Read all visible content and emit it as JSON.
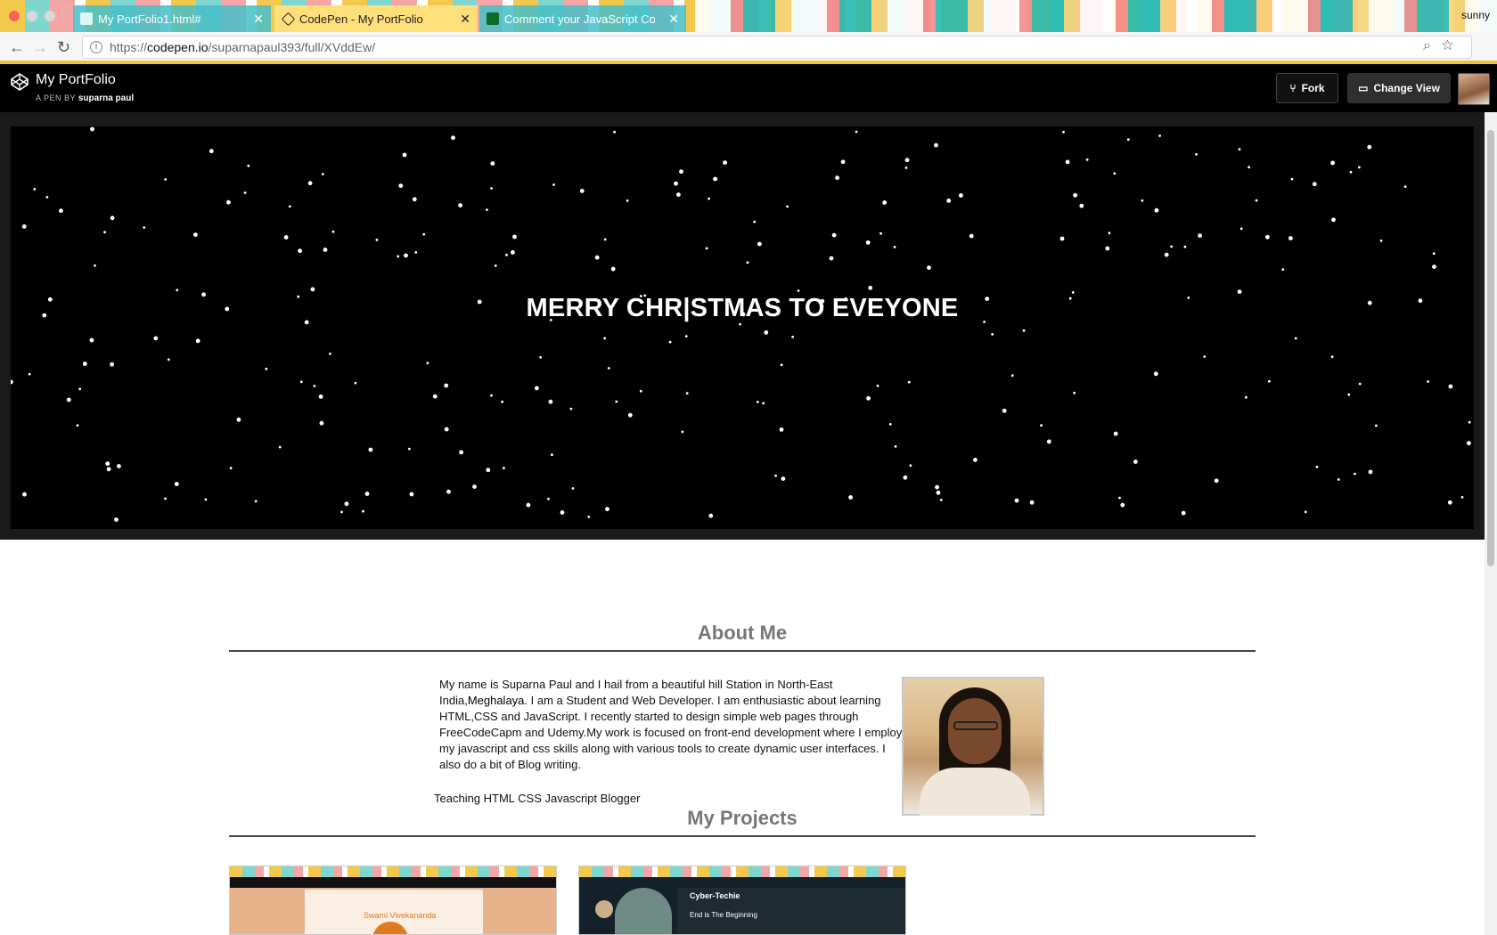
{
  "browser": {
    "tabs": [
      {
        "title": "My PortFolio1.html#",
        "active": false
      },
      {
        "title": "CodePen - My PortFolio",
        "active": true
      },
      {
        "title": "Comment your JavaScript Co",
        "active": false
      }
    ],
    "profile_name": "sunny",
    "url_prefix": "https://",
    "url_host": "codepen.io",
    "url_path": "/suparnapaul393/full/XVddEw/",
    "colors": {
      "theme_yellow": "#f1c230",
      "theme_teal": "#46bec8"
    }
  },
  "codepen": {
    "pen_title": "My PortFolio",
    "byline_prefix": "A PEN BY",
    "author": "suparna paul",
    "fork_label": "Fork",
    "change_view_label": "Change View"
  },
  "page": {
    "hero_text": "MERRY CHR|STMAS TO EVEYONE",
    "about_title": "About Me",
    "about_intro": "My name is Suparna Paul and I hail from a beautiful hill Station in North-East India,",
    "about_place": "Meghalaya",
    "about_rest": ". I am a Student and Web Developer. I am enthusiastic about learning HTML,CSS and JavaScript. I recently started to design simple web pages through FreeCodeCapm and Udemy.My work is focused on front-end development where I employ my javascript and css skills along with various tools to create dynamic user interfaces. I also do a bit of Blog writing.",
    "skills": "Teaching HTML CSS Javascript Blogger",
    "projects_title": "My Projects",
    "projects": [
      {
        "quote_name": "Swami Vivekananda"
      },
      {
        "blog_name": "Cyber-Techie",
        "post_title": "End is The Beginning"
      }
    ]
  }
}
